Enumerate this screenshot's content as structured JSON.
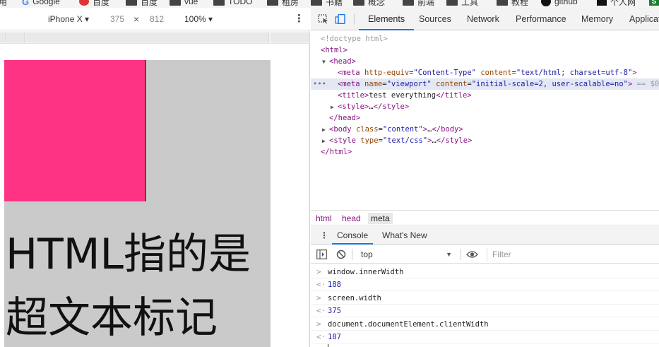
{
  "bookmarks": [
    {
      "label": "用",
      "kind": "text"
    },
    {
      "label": "Google",
      "kind": "google"
    },
    {
      "label": "百度",
      "kind": "weibo"
    },
    {
      "label": "百度",
      "kind": "folder"
    },
    {
      "label": "vue",
      "kind": "folder"
    },
    {
      "label": "TODO",
      "kind": "folder"
    },
    {
      "label": "租房",
      "kind": "folder"
    },
    {
      "label": "书籍",
      "kind": "folder"
    },
    {
      "label": "概念",
      "kind": "folder"
    },
    {
      "label": "前端",
      "kind": "folder"
    },
    {
      "label": "工具",
      "kind": "folder"
    },
    {
      "label": "教程",
      "kind": "folder"
    },
    {
      "label": "github",
      "kind": "github"
    },
    {
      "label": "个人网",
      "kind": "square"
    },
    {
      "label": "S",
      "kind": "s"
    }
  ],
  "device_toolbar": {
    "device": "iPhone X ▾",
    "width": "375",
    "times": "×",
    "height": "812",
    "zoom": "100% ▾",
    "more": "⋮"
  },
  "page": {
    "colors": {
      "box": "#ff3383",
      "background": "#cacaca"
    },
    "line1": "HTML指的是",
    "line2": "超文本标记"
  },
  "devtools": {
    "tabs": [
      "Elements",
      "Sources",
      "Network",
      "Performance",
      "Memory",
      "Applicat"
    ],
    "active_tab": "Elements",
    "icons": [
      "inspect-icon",
      "device-toggle-icon"
    ],
    "elements": [
      {
        "text": "<!doctype html>"
      },
      {
        "tag_open": "<html>"
      },
      {
        "tri": "▼",
        "tag_open": "<head>"
      },
      {
        "meta1_tag": "<meta ",
        "a1": "http-equiv",
        "v1": "\"Content-Type\"",
        "a2": "content",
        "v2": "\"text/html; charset=utf-8\"",
        "close": ">"
      },
      {
        "meta2_tag": "<meta ",
        "a1": "name",
        "v1": "\"viewport\"",
        "a2": "content",
        "v2": "\"initial-scale=2, user-scalable=no\"",
        "close": ">",
        "eq": " == $0"
      },
      {
        "title_open": "<title>",
        "title_text": "test everything",
        "title_close": "</title>"
      },
      {
        "tri": "▶",
        "style_open": "<style>",
        "style_dots": "…",
        "style_close": "</style>"
      },
      {
        "tag_close": "</head>"
      },
      {
        "tri": "▶",
        "body_open": "<body ",
        "a1": "class",
        "v1": "\"content\"",
        "close": ">",
        "dots": "…",
        "body_close": "</body>"
      },
      {
        "tri": "▶",
        "style2_open": "<style ",
        "a1": "type",
        "v1": "\"text/css\"",
        "close": ">",
        "dots": "…",
        "style2_close": "</style>"
      },
      {
        "tag_close": "</html>"
      }
    ],
    "row_dots": "•••",
    "breadcrumbs": [
      "html",
      "head",
      "meta"
    ],
    "console_tabs": [
      "Console",
      "What's New"
    ],
    "console_menu": "⋮",
    "context": "top",
    "context_arrow": "▼",
    "filter_placeholder": "Filter",
    "console": [
      {
        "prompt": ">",
        "text": "window.innerWidth",
        "kind": "input"
      },
      {
        "prompt": "<·",
        "text": "188",
        "kind": "result"
      },
      {
        "prompt": ">",
        "text": "screen.width",
        "kind": "input"
      },
      {
        "prompt": "<·",
        "text": "375",
        "kind": "result"
      },
      {
        "prompt": ">",
        "text": "document.documentElement.clientWidth",
        "kind": "input"
      },
      {
        "prompt": "<·",
        "text": "187",
        "kind": "result"
      }
    ]
  }
}
